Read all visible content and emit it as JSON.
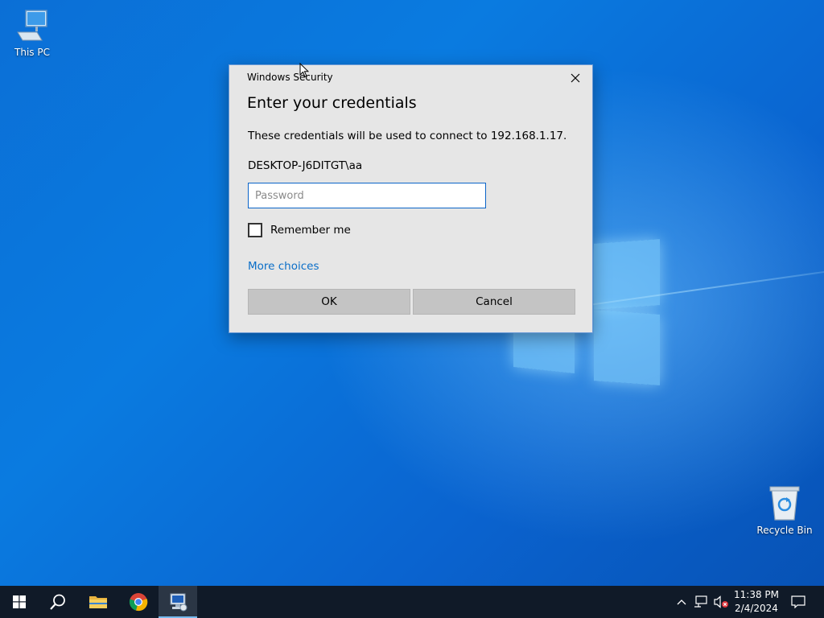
{
  "desktop": {
    "icons": [
      {
        "label": "This PC",
        "icon": "this-pc-icon"
      },
      {
        "label": "Recycle Bin",
        "icon": "recycle-bin-icon"
      }
    ],
    "accent_color": "#0a62c9"
  },
  "dialog": {
    "caption": "Windows Security",
    "heading": "Enter your credentials",
    "info": "These credentials will be used to connect to 192.168.1.17.",
    "username": "DESKTOP-J6DITGT\\aa",
    "password": {
      "placeholder": "Password",
      "value": ""
    },
    "remember_label": "Remember me",
    "remember_checked": false,
    "more_choices": "More choices",
    "ok_label": "OK",
    "cancel_label": "Cancel",
    "link_color": "#0a6ec8"
  },
  "taskbar": {
    "apps": [
      {
        "name": "start",
        "icon": "windows-start-icon"
      },
      {
        "name": "search",
        "icon": "search-icon"
      },
      {
        "name": "file-explorer",
        "icon": "folder-icon"
      },
      {
        "name": "chrome",
        "icon": "chrome-icon"
      },
      {
        "name": "remote-desktop",
        "icon": "remote-desktop-icon",
        "active": true
      }
    ],
    "tray": [
      "chevron-up-icon",
      "network-icon",
      "volume-muted-icon"
    ],
    "time": "11:38 PM",
    "date": "2/4/2024",
    "notification_icon": "action-center-icon"
  }
}
